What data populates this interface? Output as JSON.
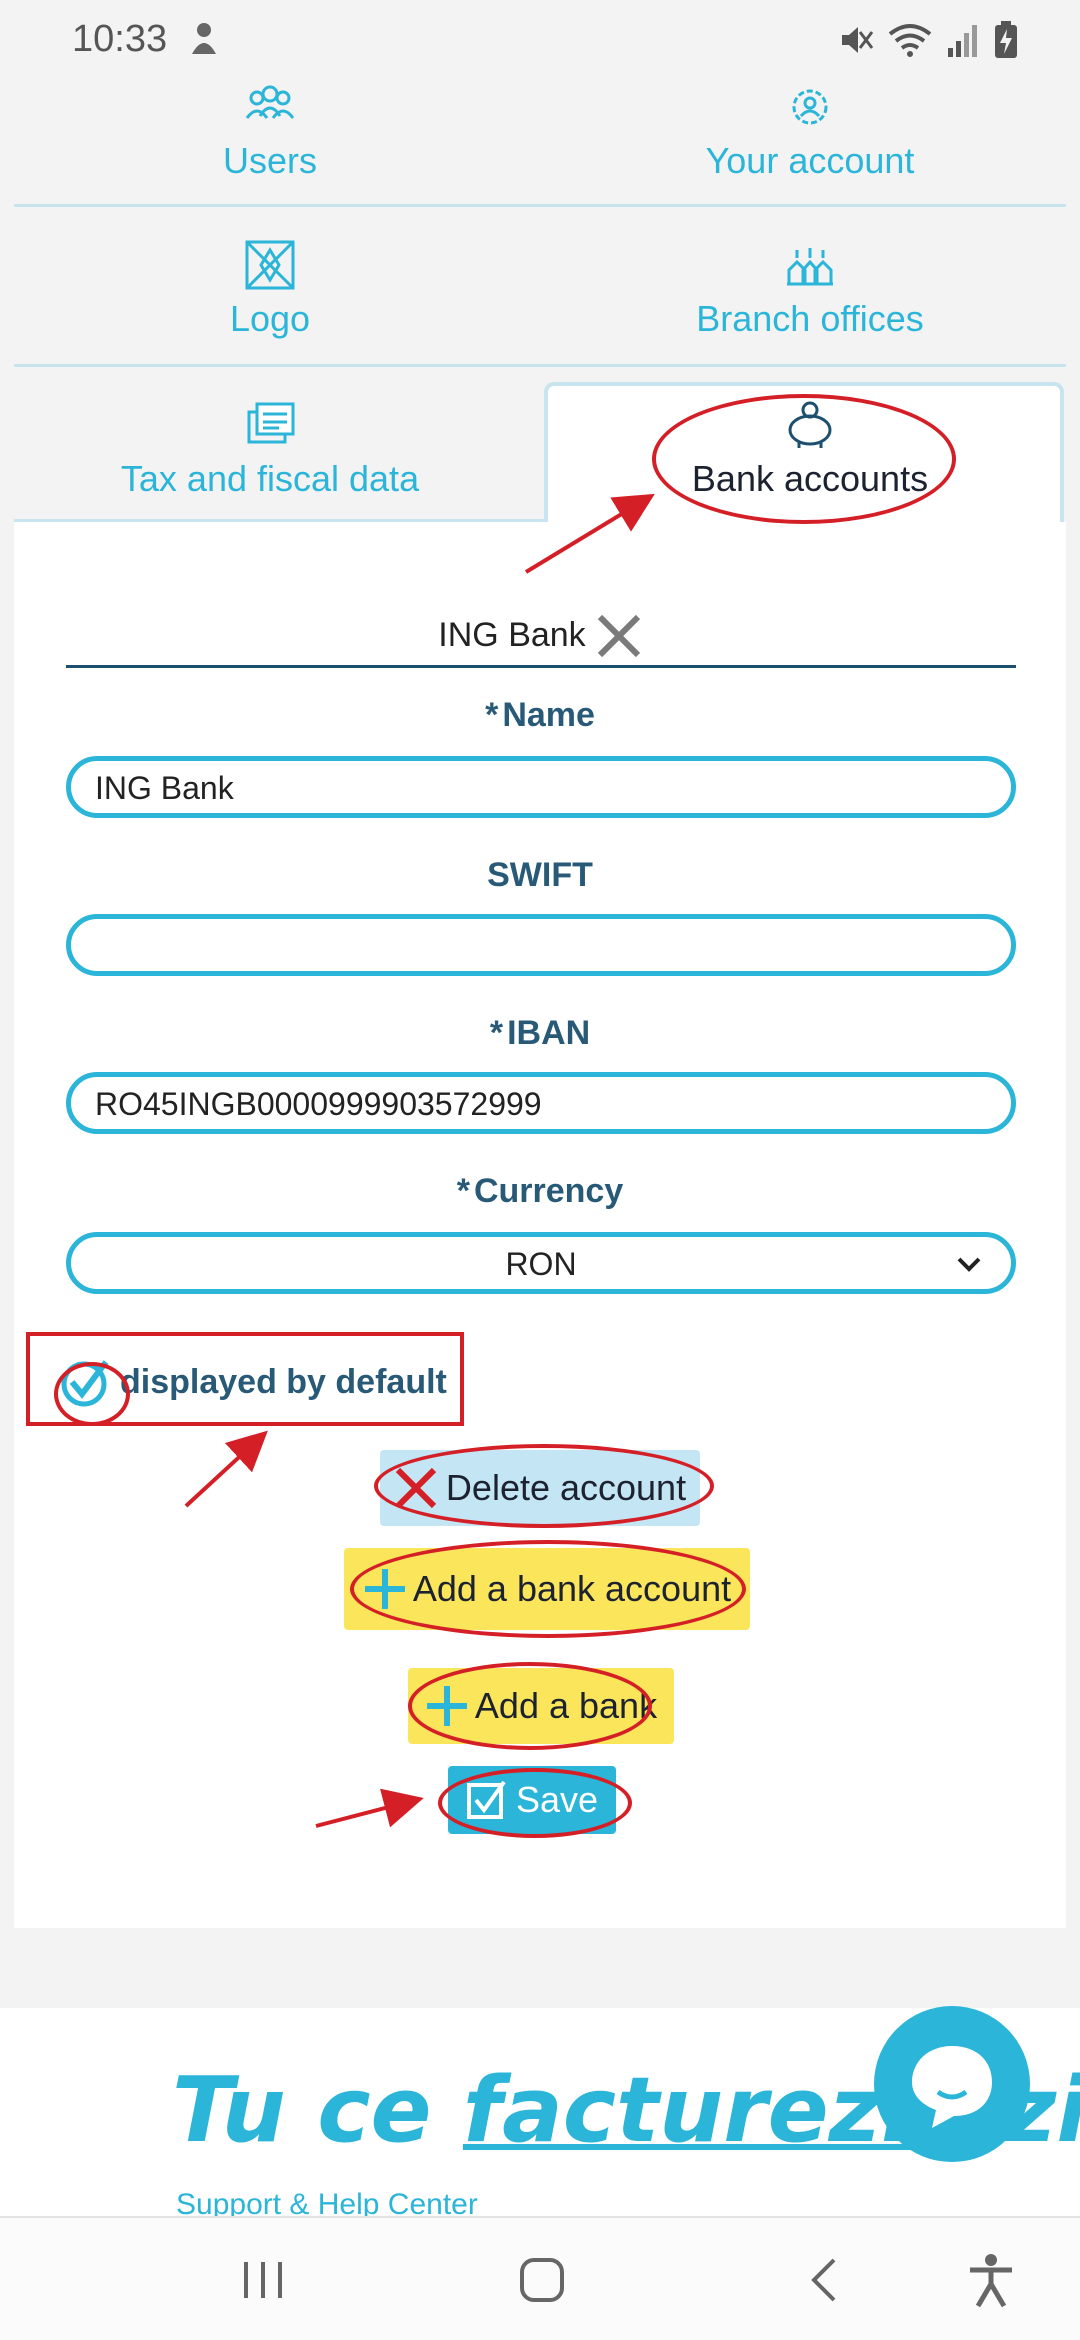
{
  "status_bar": {
    "time": "10:33"
  },
  "tabs": {
    "users": "Users",
    "your_account": "Your account",
    "logo": "Logo",
    "branch_offices": "Branch offices",
    "tax": "Tax and fiscal data",
    "bank_accounts": "Bank accounts"
  },
  "account_header": {
    "title": "ING Bank"
  },
  "form": {
    "name_label": "Name",
    "name_value": "ING Bank",
    "swift_label": "SWIFT",
    "swift_value": "",
    "iban_label": "IBAN",
    "iban_value": "RO45INGB0000999903572999",
    "currency_label": "Currency",
    "currency_value": "RON",
    "required_mark": "*",
    "default_label": "displayed by default"
  },
  "buttons": {
    "delete": "Delete account",
    "add_bank_account": "Add a bank account",
    "add_bank": "Add a bank",
    "save": "Save"
  },
  "footer": {
    "slogan_part1": "Tu ce ",
    "slogan_part2": "facturezi",
    "slogan_part3": " azi",
    "link": "Support & Help Center"
  },
  "colors": {
    "accent": "#2bb5d9",
    "annotation": "#d51f26",
    "yellow": "#fbe55b",
    "light_blue": "#c4e5f4"
  }
}
